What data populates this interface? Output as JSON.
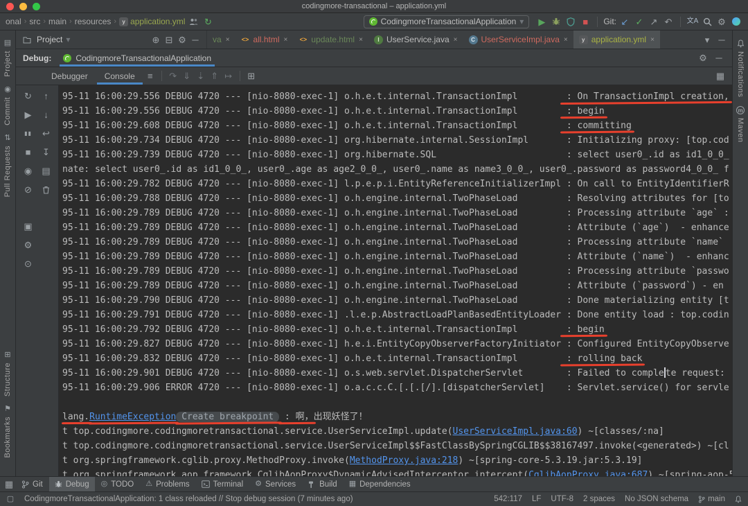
{
  "title_bar": {
    "title": "codingmore-transactional – application.yml"
  },
  "toolbar": {
    "breadcrumbs": [
      "onal",
      "src",
      "main",
      "resources",
      "application.yml"
    ],
    "breadcrumb_file_color": "#99a74f",
    "run_config": "CodingmoreTransactionalApplication",
    "git_label": "Git:",
    "translate_label": "文A"
  },
  "project_panel": {
    "title": "Project"
  },
  "editor_tabs": [
    {
      "label": "va",
      "color": "#6a8759"
    },
    {
      "label": "all.html",
      "color": "#cf6a5f"
    },
    {
      "label": "update.html",
      "color": "#6a8759"
    },
    {
      "label": "UserService.java",
      "color": "#bcbcbc"
    },
    {
      "label": "UserServiceImpl.java",
      "color": "#cf6a5f"
    },
    {
      "label": "application.yml",
      "color": "#aab344",
      "active": true
    }
  ],
  "debug_panel": {
    "label": "Debug:",
    "session_tab": "CodingmoreTransactionalApplication",
    "tabs": [
      {
        "label": "Debugger"
      },
      {
        "label": "Console",
        "active": true
      }
    ]
  },
  "left_stripe": {
    "items": [
      {
        "label": "Project"
      },
      {
        "label": "Commit"
      },
      {
        "label": "Pull Requests"
      },
      {
        "label": "Structure"
      },
      {
        "label": "Bookmarks"
      }
    ]
  },
  "right_stripe": {
    "items": [
      {
        "label": "Notifications"
      },
      {
        "label": "Maven"
      }
    ]
  },
  "console": {
    "lines": [
      {
        "segments": [
          {
            "t": "95-11 16:00:29.556 DEBUG 4720 --- [nio-8080-exec-1] o.h.e.t.internal.TransactionImpl        "
          },
          {
            "t": " : On TransactionImpl creation,",
            "m": true
          }
        ]
      },
      {
        "segments": [
          {
            "t": "95-11 16:00:29.556 DEBUG 4720 --- [nio-8080-exec-1] o.h.e.t.internal.TransactionImpl        "
          },
          {
            "t": " : begin",
            "m": true
          }
        ]
      },
      {
        "segments": [
          {
            "t": "95-11 16:00:29.608 DEBUG 4720 --- [nio-8080-exec-1] o.h.e.t.internal.TransactionImpl        "
          },
          {
            "t": " : committing",
            "m": true
          }
        ]
      },
      {
        "segments": [
          {
            "t": "95-11 16:00:29.734 DEBUG 4720 --- [nio-8080-exec-1] org.hibernate.internal.SessionImpl       : Initializing proxy: [top.cod"
          }
        ]
      },
      {
        "segments": [
          {
            "t": "95-11 16:00:29.739 DEBUG 4720 --- [nio-8080-exec-1] org.hibernate.SQL                        : select user0_.id as id1_0_0_"
          }
        ]
      },
      {
        "segments": [
          {
            "t": "nate: select user0_.id as id1_0_0_, user0_.age as age2_0_0_, user0_.name as name3_0_0_, user0_.password as password4_0_0_ f"
          }
        ]
      },
      {
        "segments": [
          {
            "t": "95-11 16:00:29.782 DEBUG 4720 --- [nio-8080-exec-1] l.p.e.p.i.EntityReferenceInitializerImpl : On call to EntityIdentifierR"
          }
        ]
      },
      {
        "segments": [
          {
            "t": "95-11 16:00:29.788 DEBUG 4720 --- [nio-8080-exec-1] o.h.engine.internal.TwoPhaseLoad         : Resolving attributes for [to"
          }
        ]
      },
      {
        "segments": [
          {
            "t": "95-11 16:00:29.789 DEBUG 4720 --- [nio-8080-exec-1] o.h.engine.internal.TwoPhaseLoad         : Processing attribute `age` :"
          }
        ]
      },
      {
        "segments": [
          {
            "t": "95-11 16:00:29.789 DEBUG 4720 --- [nio-8080-exec-1] o.h.engine.internal.TwoPhaseLoad         : Attribute (`age`)  - enhance"
          }
        ]
      },
      {
        "segments": [
          {
            "t": "95-11 16:00:29.789 DEBUG 4720 --- [nio-8080-exec-1] o.h.engine.internal.TwoPhaseLoad         : Processing attribute `name`"
          }
        ]
      },
      {
        "segments": [
          {
            "t": "95-11 16:00:29.789 DEBUG 4720 --- [nio-8080-exec-1] o.h.engine.internal.TwoPhaseLoad         : Attribute (`name`)  - enhanc"
          }
        ]
      },
      {
        "segments": [
          {
            "t": "95-11 16:00:29.789 DEBUG 4720 --- [nio-8080-exec-1] o.h.engine.internal.TwoPhaseLoad         : Processing attribute `passwo"
          }
        ]
      },
      {
        "segments": [
          {
            "t": "95-11 16:00:29.789 DEBUG 4720 --- [nio-8080-exec-1] o.h.engine.internal.TwoPhaseLoad         : Attribute (`password`) - en"
          }
        ]
      },
      {
        "segments": [
          {
            "t": "95-11 16:00:29.790 DEBUG 4720 --- [nio-8080-exec-1] o.h.engine.internal.TwoPhaseLoad         : Done materializing entity [t"
          }
        ]
      },
      {
        "segments": [
          {
            "t": "95-11 16:00:29.791 DEBUG 4720 --- [nio-8080-exec-1] .l.e.p.AbstractLoadPlanBasedEntityLoader : Done entity load : top.codin"
          }
        ]
      },
      {
        "segments": [
          {
            "t": "95-11 16:00:29.792 DEBUG 4720 --- [nio-8080-exec-1] o.h.e.t.internal.TransactionImpl        "
          },
          {
            "t": " : begin",
            "m": true
          }
        ]
      },
      {
        "segments": [
          {
            "t": "95-11 16:00:29.827 DEBUG 4720 --- [nio-8080-exec-1] h.e.i.EntityCopyObserverFactoryInitiator : Configured EntityCopyObserve"
          }
        ]
      },
      {
        "segments": [
          {
            "t": "95-11 16:00:29.832 DEBUG 4720 --- [nio-8080-exec-1] o.h.e.t.internal.TransactionImpl        "
          },
          {
            "t": " : rolling back",
            "m": true
          }
        ]
      },
      {
        "segments": [
          {
            "t": "95-11 16:00:29.901 DEBUG 4720 --- [nio-8080-exec-1] o.s.web.servlet.DispatcherServlet        : Failed to comple"
          },
          {
            "caret": true
          },
          {
            "t": "te request:"
          }
        ]
      },
      {
        "segments": [
          {
            "t": "95-11 16:00:29.906 ERROR 4720 --- [nio-8080-exec-1] o.a.c.c.C.[.[.[/].[dispatcherServlet]    : Servlet.service() for servle"
          }
        ]
      },
      {
        "segments": []
      },
      {
        "segments": [
          {
            "t": "lang.",
            "m": true
          },
          {
            "t": "RuntimeException",
            "link": true,
            "m": true
          },
          {
            "t": " Create breakpoint ",
            "chip": true,
            "m": true
          },
          {
            "t": " : 啊，",
            "m": true
          },
          {
            "t": "出现妖怪了！"
          }
        ]
      },
      {
        "segments": [
          {
            "t": "t top.codingmore.codingmoretransactional.service.UserServiceImpl.update("
          },
          {
            "t": "UserServiceImpl.java:60",
            "link": true
          },
          {
            "t": ") ~[classes/:na]"
          }
        ]
      },
      {
        "segments": [
          {
            "t": "t top.codingmore.codingmoretransactional.service.UserServiceImpl$$FastClassBySpringCGLIB$$38167497.invoke(<generated>) ~[cl"
          }
        ]
      },
      {
        "segments": [
          {
            "t": "t org.springframework.cglib.proxy.MethodProxy.invoke("
          },
          {
            "t": "MethodProxy.java:218",
            "link": true
          },
          {
            "t": ") ~[spring-core-5.3.19.jar:5.3.19]"
          }
        ]
      },
      {
        "segments": [
          {
            "t": "t org.springframework.aop.framework.CglibAopProxy$DynamicAdvisedInterceptor.intercept("
          },
          {
            "t": "CglibAopProxy.java:687",
            "link": true
          },
          {
            "t": ") ~[spring-aop-5.3.19.jar:5.3.19]"
          }
        ]
      }
    ]
  },
  "bottom_bar": {
    "items": [
      {
        "label": "Git"
      },
      {
        "label": "Debug",
        "active": true
      },
      {
        "label": "TODO"
      },
      {
        "label": "Problems"
      },
      {
        "label": "Terminal"
      },
      {
        "label": "Services"
      },
      {
        "label": "Build"
      },
      {
        "label": "Dependencies"
      }
    ]
  },
  "status_bar": {
    "message": "CodingmoreTransactionalApplication: 1 class reloaded // Stop debug session (7 minutes ago)",
    "position": "542:117",
    "line_ending": "LF",
    "encoding": "UTF-8",
    "indent": "2 spaces",
    "schema": "No JSON schema",
    "branch": "main"
  },
  "colors": {
    "accent_underline": "#4a88c7",
    "annotation_red": "#e8402d",
    "link_blue": "#5394ec"
  },
  "icons": {
    "chevron-right": "›",
    "chevron-down": "▾",
    "reload-classes": "↻",
    "run": "▶",
    "stop": "■",
    "update-project": "↙",
    "commit-check": "✓",
    "push": "↗",
    "rollback": "↶",
    "settings-gear": "⚙",
    "locate": "⊕",
    "collapse-all": "⊟",
    "hide": "─",
    "menu": "≡",
    "step-over": "↷",
    "step-into": "⇓",
    "force-step-into": "⇣",
    "step-out": "⇑",
    "run-to-cursor": "↦",
    "restore-layout": "⊞",
    "layout": "▦",
    "rerun": "↻",
    "resume": "▶",
    "pause": "▮▮",
    "view-breakpoints": "◉",
    "mute-breakpoints": "⊘",
    "thread-dump": "▣",
    "pin": "⊙",
    "up-stack": "↑",
    "down-stack": "↓",
    "soft-wrap": "↩",
    "scroll-end": "↧",
    "print": "▤",
    "switcher": "▦",
    "todo": "◎",
    "problems": "⚠",
    "services": "⚙",
    "dependencies": "▦",
    "project": "▤",
    "commit-tool": "◉",
    "pull-requests": "⇅",
    "structure": "⊞",
    "bookmarks": "⚑",
    "monitor": "▢",
    "html-file": "<>",
    "interface-badge": "I",
    "class-badge": "C",
    "yaml-file": "y"
  }
}
